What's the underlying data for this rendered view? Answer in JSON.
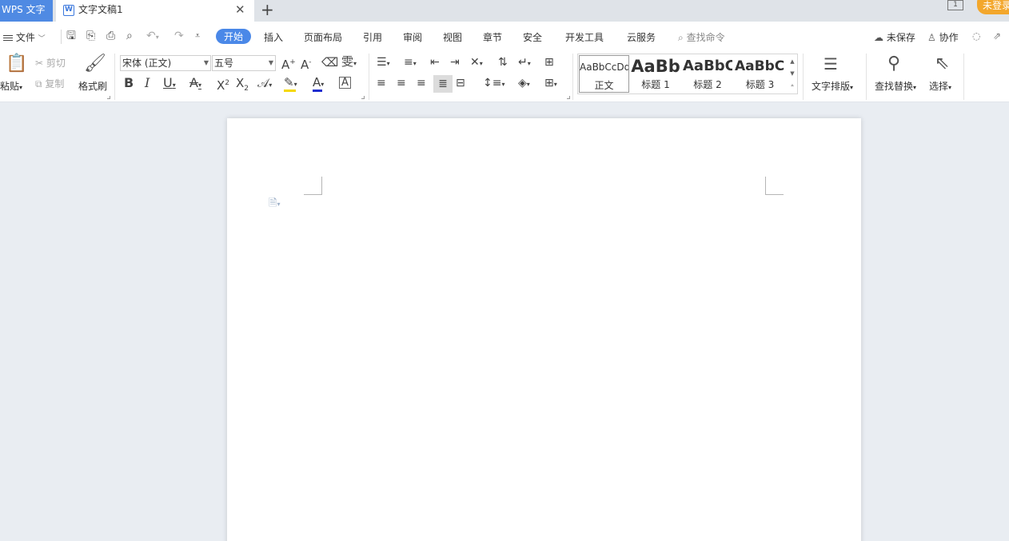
{
  "titlebar": {
    "app_name": "WPS 文字",
    "doc_tab_title": "文字文稿1",
    "close_glyph": "✕",
    "new_tab_glyph": "+",
    "window_count": "1",
    "login_label": "未登录"
  },
  "menubar": {
    "file_label": "文件",
    "tabs": [
      "开始",
      "插入",
      "页面布局",
      "引用",
      "审阅",
      "视图",
      "章节",
      "安全",
      "开发工具",
      "云服务"
    ],
    "active_tab": "开始",
    "search_label": "查找命令",
    "unsaved_label": "未保存",
    "collab_label": "协作"
  },
  "ribbon": {
    "paste_label": "粘贴",
    "cut_label": "剪切",
    "copy_label": "复制",
    "format_painter_label": "格式刷",
    "font_name": "宋体 (正文)",
    "font_size": "五号",
    "styles": [
      {
        "preview": "AaBbCcDd",
        "name": "正文"
      },
      {
        "preview": "AaBb",
        "name": "标题 1"
      },
      {
        "preview": "AaBbC",
        "name": "标题 2"
      },
      {
        "preview": "AaBbCc",
        "name": "标题 3"
      }
    ],
    "text_layout_label": "文字排版",
    "find_replace_label": "查找替换",
    "select_label": "选择"
  },
  "colors": {
    "accent": "#4a88e8",
    "app_tab": "#4f8ae3",
    "login": "#f3a72c",
    "highlight_bar": "#f5d800",
    "font_color_bar": "#1d2ccf"
  }
}
